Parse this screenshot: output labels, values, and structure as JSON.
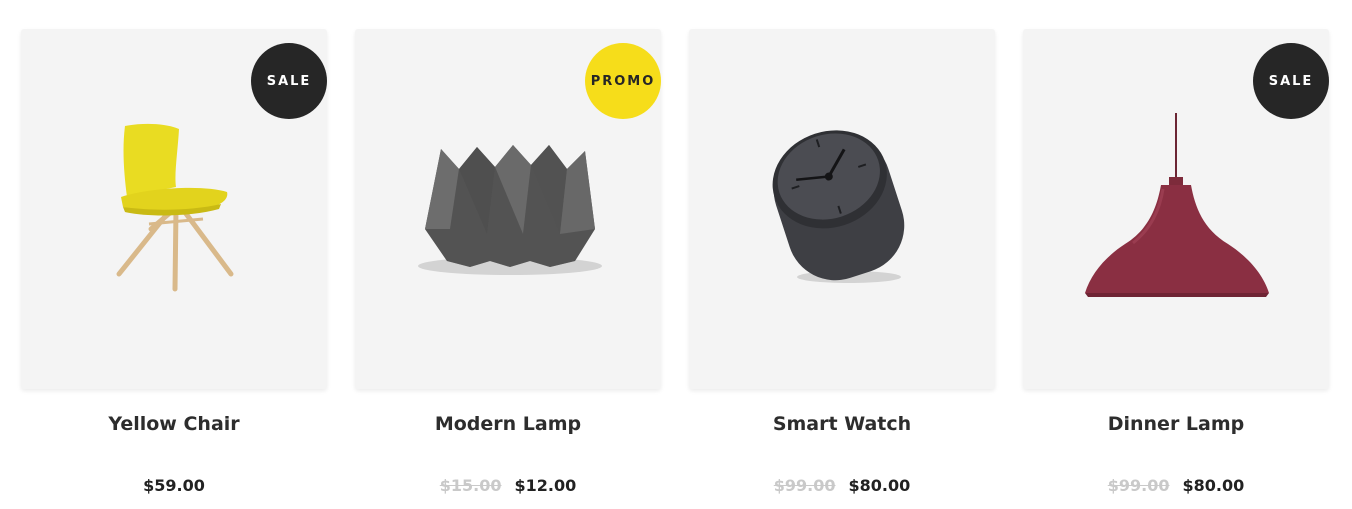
{
  "products": [
    {
      "title": "Yellow Chair",
      "badge": "SALE",
      "old_price": "",
      "price": "$59.00",
      "image": "yellow-chair-image"
    },
    {
      "title": "Modern Lamp",
      "badge": "PROMO",
      "old_price": "$15.00",
      "price": "$12.00",
      "image": "faceted-vase-image"
    },
    {
      "title": "Smart Watch",
      "badge": "",
      "old_price": "$99.00",
      "price": "$80.00",
      "image": "table-clock-image"
    },
    {
      "title": "Dinner Lamp",
      "badge": "SALE",
      "old_price": "$99.00",
      "price": "$80.00",
      "image": "pendant-lamp-image"
    }
  ],
  "colors": {
    "card_bg": "#f4f4f4",
    "badge_sale": "#262626",
    "badge_promo": "#f6dd1a",
    "old_price": "#c9c9c9"
  }
}
